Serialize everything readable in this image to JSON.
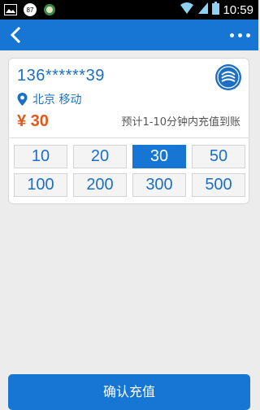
{
  "status_bar": {
    "notification_badge": "87",
    "time": "10:59"
  },
  "recharge": {
    "phone": "136******39",
    "region": "北京 移动",
    "price": "¥ 30",
    "eta": "预计1-10分钟内充值到账",
    "selected_amount": "30",
    "amounts": [
      "10",
      "20",
      "30",
      "50",
      "100",
      "200",
      "300",
      "500"
    ]
  },
  "confirm_button": {
    "label": "确认充值"
  },
  "colors": {
    "primary": "#1775d3",
    "price": "#e4571b",
    "accent_text": "#1d6fc3"
  }
}
